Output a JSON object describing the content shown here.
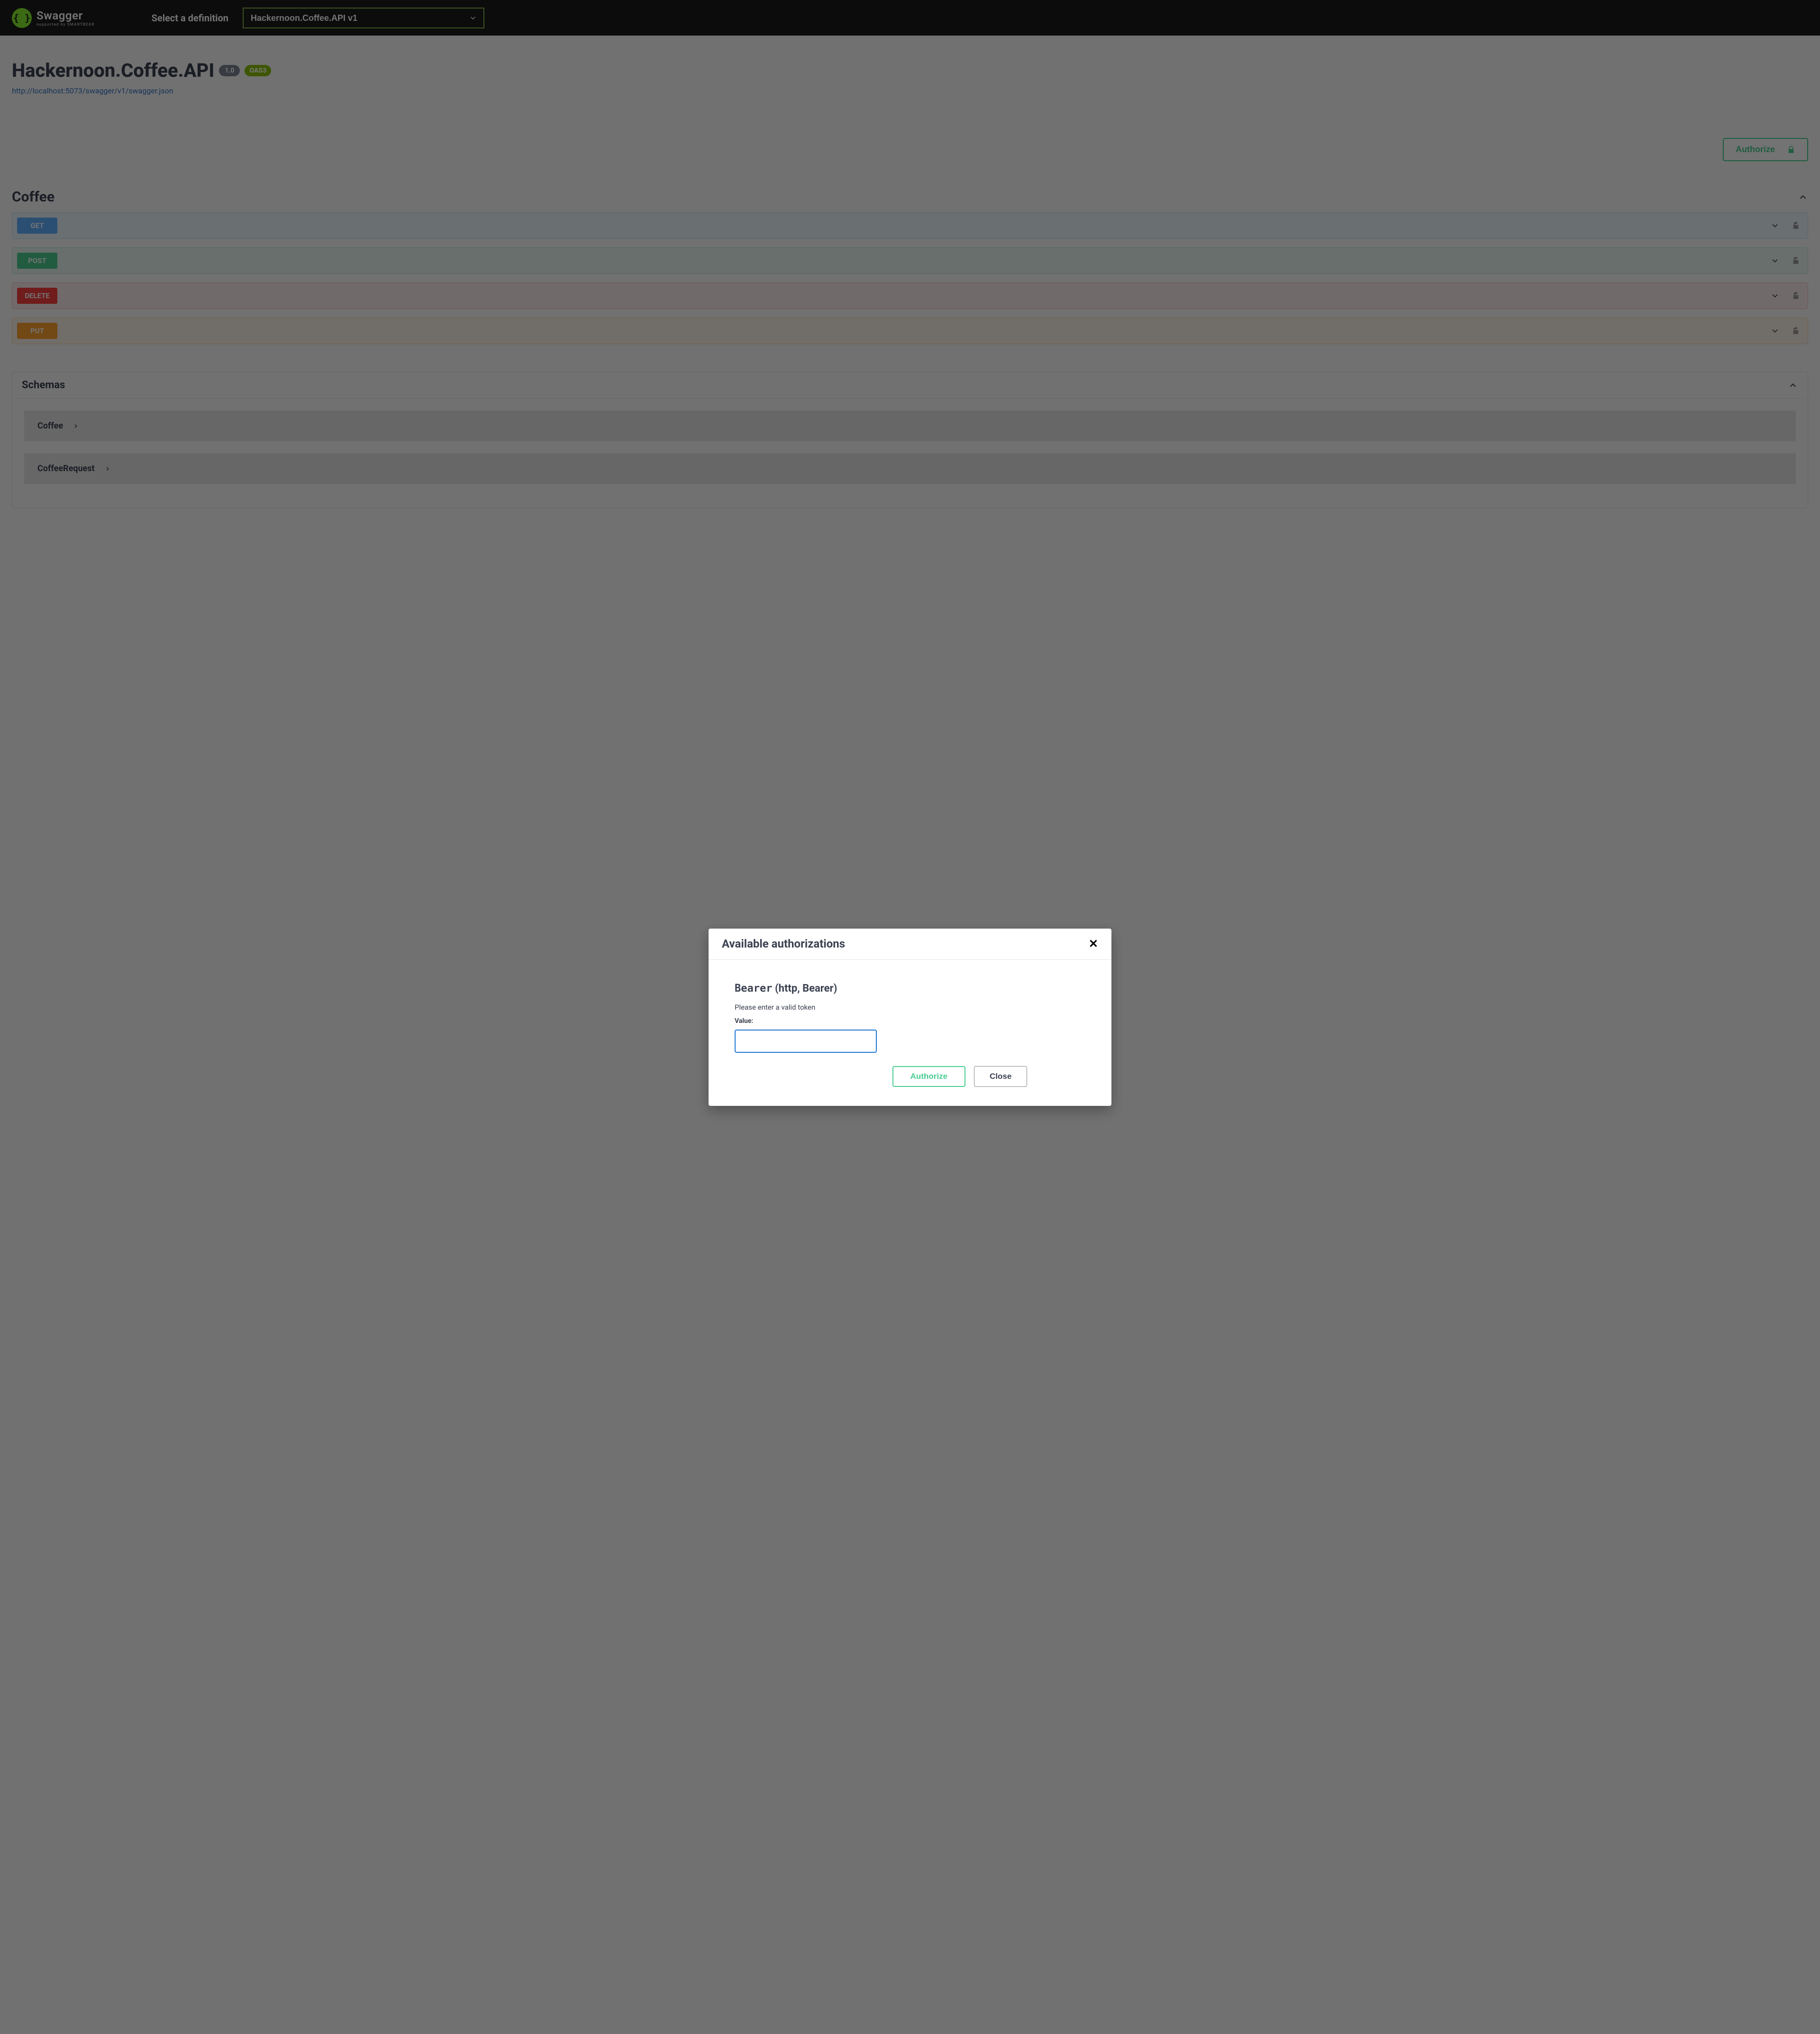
{
  "header": {
    "brand": "Swagger",
    "subBrand": "supported by SMARTBEAR",
    "defLabel": "Select a definition",
    "defSelected": "Hackernoon.Coffee.API v1"
  },
  "info": {
    "title": "Hackernoon.Coffee.API",
    "versionBadge": "1.0",
    "oasBadge": "OAS3",
    "swaggerUrl": "http://localhost:5073/swagger/v1/swagger.json"
  },
  "authorizeBtn": "Authorize",
  "section": {
    "title": "Coffee"
  },
  "ops": [
    {
      "method": "GET",
      "cls": "get"
    },
    {
      "method": "POST",
      "cls": "post"
    },
    {
      "method": "DELETE",
      "cls": "delete"
    },
    {
      "method": "PUT",
      "cls": "put"
    }
  ],
  "schemas": {
    "title": "Schemas",
    "items": [
      "Coffee",
      "CoffeeRequest"
    ]
  },
  "modal": {
    "title": "Available authorizations",
    "scheme": "Bearer",
    "schemeType": " (http, Bearer)",
    "description": "Please enter a valid token",
    "valueLabel": "Value:",
    "value": "",
    "authorize": "Authorize",
    "close": "Close"
  }
}
